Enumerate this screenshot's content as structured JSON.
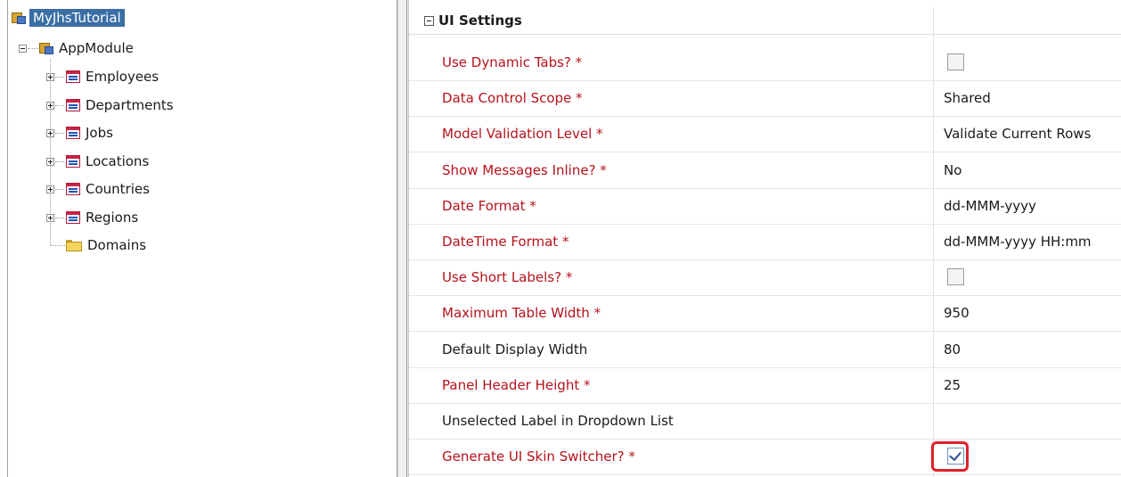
{
  "tree": {
    "root": {
      "label": "MyJhsTutorial",
      "icon": "project-icon"
    },
    "app_module": {
      "label": "AppModule",
      "icon": "app-module-icon"
    },
    "children": [
      {
        "label": "Employees",
        "icon": "view-object-icon",
        "expandable": true
      },
      {
        "label": "Departments",
        "icon": "view-object-icon",
        "expandable": true
      },
      {
        "label": "Jobs",
        "icon": "view-object-icon",
        "expandable": true
      },
      {
        "label": "Locations",
        "icon": "view-object-icon",
        "expandable": true
      },
      {
        "label": "Countries",
        "icon": "view-object-icon",
        "expandable": true
      },
      {
        "label": "Regions",
        "icon": "view-object-icon",
        "expandable": true
      },
      {
        "label": "Domains",
        "icon": "folder-icon",
        "expandable": false
      }
    ]
  },
  "grid": {
    "section_title": "UI Settings",
    "rows": [
      {
        "label": "Use Dynamic Tabs? *",
        "required": true,
        "type": "checkbox",
        "checked": false
      },
      {
        "label": "Data Control Scope *",
        "required": true,
        "type": "text",
        "value": "Shared"
      },
      {
        "label": "Model Validation Level *",
        "required": true,
        "type": "text",
        "value": "Validate Current Rows"
      },
      {
        "label": "Show Messages Inline? *",
        "required": true,
        "type": "text",
        "value": "No"
      },
      {
        "label": "Date Format *",
        "required": true,
        "type": "text",
        "value": "dd-MMM-yyyy"
      },
      {
        "label": "DateTime Format *",
        "required": true,
        "type": "text",
        "value": "dd-MMM-yyyy HH:mm"
      },
      {
        "label": "Use Short Labels? *",
        "required": true,
        "type": "checkbox",
        "checked": false
      },
      {
        "label": "Maximum Table Width *",
        "required": true,
        "type": "text",
        "value": "950"
      },
      {
        "label": "Default Display Width",
        "required": false,
        "type": "text",
        "value": "80"
      },
      {
        "label": "Panel Header Height *",
        "required": true,
        "type": "text",
        "value": "25"
      },
      {
        "label": "Unselected Label in Dropdown List",
        "required": false,
        "type": "text",
        "value": ""
      },
      {
        "label": "Generate UI Skin Switcher? *",
        "required": true,
        "type": "checkbox",
        "checked": true,
        "highlighted": true
      }
    ]
  },
  "colors": {
    "required_label": "#b5121b",
    "selection": "#3a6ea5",
    "highlight_border": "#e0202a"
  }
}
